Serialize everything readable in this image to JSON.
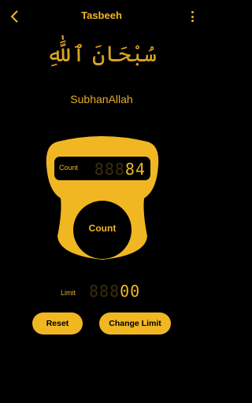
{
  "appbar": {
    "title": "Tasbeeh",
    "back_icon": "chevron-left-icon",
    "menu_icon": "more-vertical-icon"
  },
  "dhikr": {
    "arabic": "سُبْحَانَ ٱللَّٰهِ",
    "transliteration": "SubhanAllah"
  },
  "counter": {
    "label": "Count",
    "dim_digits": "888",
    "value": "84",
    "button_label": "Count"
  },
  "limit": {
    "label": "Limit",
    "dim_digits": "888",
    "value": "00"
  },
  "actions": {
    "reset_label": "Reset",
    "change_limit_label": "Change Limit"
  },
  "colors": {
    "accent": "#f0b723",
    "background": "#000000"
  }
}
